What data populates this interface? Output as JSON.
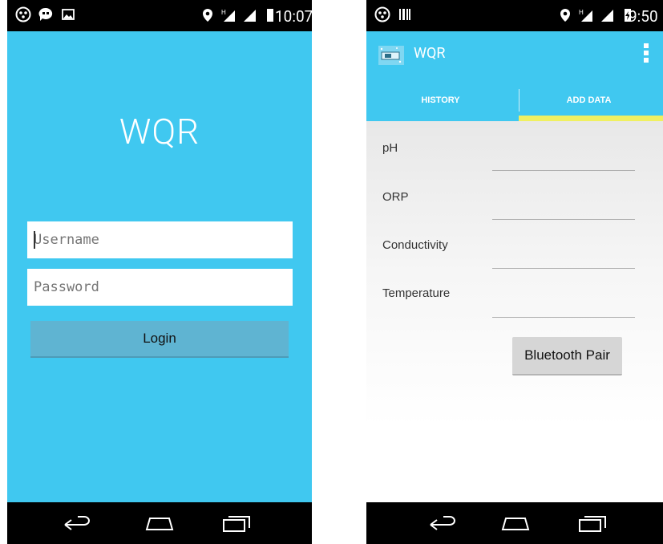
{
  "left_screen": {
    "status_bar": {
      "time": "10:07",
      "left_icons": [
        "hangouts-icon",
        "chat-icon",
        "image-icon"
      ],
      "right_icons": [
        "location-icon",
        "hspa-signal-icon",
        "signal-icon",
        "battery-icon"
      ]
    },
    "app_title": "WQR",
    "username": {
      "placeholder": "Username",
      "value": ""
    },
    "password": {
      "placeholder": "Password",
      "value": ""
    },
    "login_label": "Login",
    "nav": [
      "back-icon",
      "home-icon",
      "recents-icon"
    ]
  },
  "right_screen": {
    "status_bar": {
      "time": "9:50",
      "left_icons": [
        "hangouts-icon",
        "barcode-icon"
      ],
      "right_icons": [
        "location-icon",
        "hspa-signal-icon",
        "signal-icon",
        "battery-charging-icon"
      ]
    },
    "app_title": "WQR",
    "tabs": [
      {
        "label": "HISTORY",
        "selected": false
      },
      {
        "label": "ADD DATA",
        "selected": true
      }
    ],
    "fields": [
      {
        "label": "pH",
        "value": ""
      },
      {
        "label": "ORP",
        "value": ""
      },
      {
        "label": "Conductivity",
        "value": ""
      },
      {
        "label": "Temperature",
        "value": ""
      }
    ],
    "bluetooth_label": "Bluetooth Pair",
    "nav": [
      "back-icon",
      "home-icon",
      "recents-icon"
    ]
  },
  "colors": {
    "primary": "#40c8f0",
    "tab_indicator": "#f0f060",
    "login_button": "#5fb4d2",
    "bar": "#000000"
  }
}
